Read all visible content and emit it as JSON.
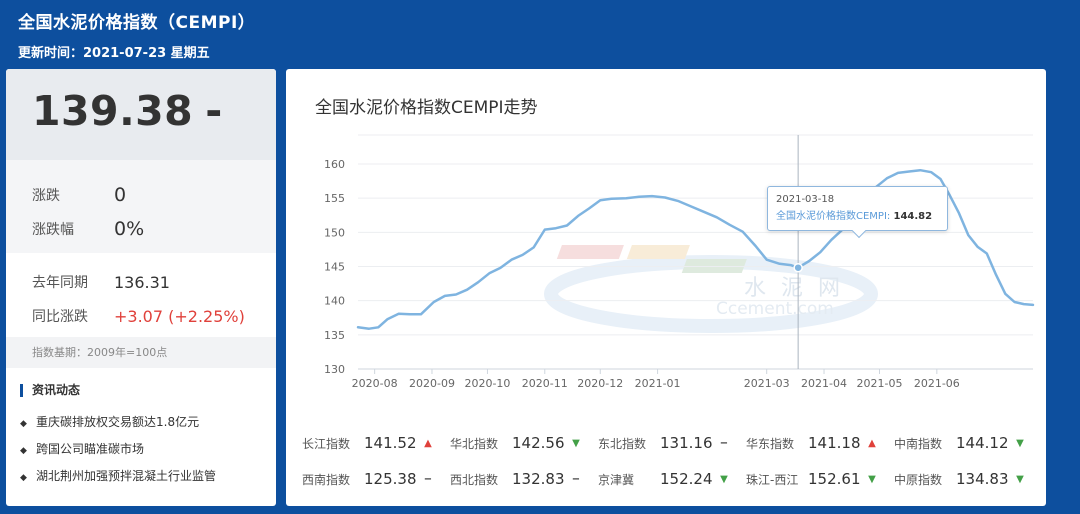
{
  "header": {
    "title": "全国水泥价格指数（CEMPI）",
    "update": "更新时间：2021-07-23 星期五"
  },
  "summary": {
    "price": "139.38",
    "price_arrow": "-",
    "change_label": "涨跌",
    "change_value": "0",
    "change_pct_label": "涨跌幅",
    "change_pct_value": "0%",
    "last_year_label": "去年同期",
    "last_year_value": "136.31",
    "yoy_label": "同比涨跌",
    "yoy_value": "+3.07",
    "yoy_pct": "(+2.25%)",
    "base_note": "指数基期：2009年=100点"
  },
  "news": {
    "title": "资讯动态",
    "items": [
      "重庆碳排放权交易额达1.8亿元",
      "跨国公司瞄准碳市场",
      "湖北荆州加强预拌混凝土行业监管"
    ]
  },
  "chart_title": "全国水泥价格指数CEMPI走势",
  "watermark": {
    "cn": "水 泥 网",
    "en": "Ccement.com"
  },
  "tooltip": {
    "date": "2021-03-18",
    "label": "全国水泥价格指数CEMPI",
    "value": "144.82"
  },
  "regions": [
    {
      "name": "长江指数",
      "value": "141.52",
      "dir": "up"
    },
    {
      "name": "华北指数",
      "value": "142.56",
      "dir": "down"
    },
    {
      "name": "东北指数",
      "value": "131.16",
      "dir": "flat"
    },
    {
      "name": "华东指数",
      "value": "141.18",
      "dir": "up"
    },
    {
      "name": "中南指数",
      "value": "144.12",
      "dir": "down"
    },
    {
      "name": "西南指数",
      "value": "125.38",
      "dir": "flat"
    },
    {
      "name": "西北指数",
      "value": "132.83",
      "dir": "flat"
    },
    {
      "name": "京津冀",
      "value": "152.24",
      "dir": "down"
    },
    {
      "name": "珠江-西江",
      "value": "152.61",
      "dir": "down"
    },
    {
      "name": "中原指数",
      "value": "134.83",
      "dir": "down"
    }
  ],
  "colors": {
    "background": "#0d4f9e",
    "line": "#7fb4e0",
    "up": "#e0413b",
    "down": "#43a047"
  },
  "chart_data": {
    "type": "line",
    "title": "全国水泥价格指数CEMPI走势",
    "xlabel": "",
    "ylabel": "",
    "ylim": [
      130,
      160
    ],
    "yticks": [
      130,
      135,
      140,
      145,
      150,
      155,
      160
    ],
    "xticks": [
      "2020-08",
      "2020-09",
      "2020-10",
      "2020-11",
      "2020-12",
      "2021-01",
      "2021-03",
      "2021-04",
      "2021-05",
      "2021-06"
    ],
    "xtick_dates": [
      "2020-08-01",
      "2020-09-01",
      "2020-10-01",
      "2020-11-01",
      "2020-12-01",
      "2021-01-01",
      "2021-03-01",
      "2021-04-01",
      "2021-05-01",
      "2021-06-01"
    ],
    "grid": true,
    "legend": "none",
    "series": [
      {
        "points": [
          [
            "2020-07-23",
            136.1
          ],
          [
            "2020-07-29",
            135.9
          ],
          [
            "2020-08-03",
            136.1
          ],
          [
            "2020-08-08",
            137.3
          ],
          [
            "2020-08-14",
            138.1
          ],
          [
            "2020-08-20",
            138.0
          ],
          [
            "2020-08-26",
            138.0
          ],
          [
            "2020-09-02",
            139.8
          ],
          [
            "2020-09-08",
            140.7
          ],
          [
            "2020-09-14",
            140.9
          ],
          [
            "2020-09-20",
            141.6
          ],
          [
            "2020-09-26",
            142.7
          ],
          [
            "2020-10-02",
            144.0
          ],
          [
            "2020-10-08",
            144.8
          ],
          [
            "2020-10-14",
            146.0
          ],
          [
            "2020-10-20",
            146.7
          ],
          [
            "2020-10-26",
            147.8
          ],
          [
            "2020-11-01",
            150.4
          ],
          [
            "2020-11-07",
            150.6
          ],
          [
            "2020-11-13",
            151.0
          ],
          [
            "2020-11-19",
            152.4
          ],
          [
            "2020-11-25",
            153.5
          ],
          [
            "2020-12-01",
            154.7
          ],
          [
            "2020-12-07",
            154.9
          ],
          [
            "2020-12-15",
            155.0
          ],
          [
            "2020-12-22",
            155.2
          ],
          [
            "2020-12-29",
            155.3
          ],
          [
            "2021-01-05",
            155.1
          ],
          [
            "2021-01-12",
            154.6
          ],
          [
            "2021-01-19",
            153.8
          ],
          [
            "2021-01-26",
            153.0
          ],
          [
            "2021-02-02",
            152.2
          ],
          [
            "2021-02-09",
            151.1
          ],
          [
            "2021-02-16",
            150.1
          ],
          [
            "2021-02-23",
            148.0
          ],
          [
            "2021-03-01",
            146.0
          ],
          [
            "2021-03-08",
            145.4
          ],
          [
            "2021-03-14",
            145.2
          ],
          [
            "2021-03-18",
            144.82
          ],
          [
            "2021-03-24",
            145.8
          ],
          [
            "2021-03-30",
            147.1
          ],
          [
            "2021-04-05",
            148.9
          ],
          [
            "2021-04-11",
            150.4
          ],
          [
            "2021-04-17",
            152.3
          ],
          [
            "2021-04-23",
            154.3
          ],
          [
            "2021-04-29",
            156.6
          ],
          [
            "2021-05-05",
            157.9
          ],
          [
            "2021-05-11",
            158.7
          ],
          [
            "2021-05-17",
            158.9
          ],
          [
            "2021-05-23",
            159.1
          ],
          [
            "2021-05-29",
            158.8
          ],
          [
            "2021-06-03",
            157.8
          ],
          [
            "2021-06-08",
            155.4
          ],
          [
            "2021-06-13",
            152.8
          ],
          [
            "2021-06-18",
            149.6
          ],
          [
            "2021-06-23",
            147.9
          ],
          [
            "2021-06-28",
            146.9
          ],
          [
            "2021-07-03",
            143.8
          ],
          [
            "2021-07-08",
            141.0
          ],
          [
            "2021-07-13",
            139.8
          ],
          [
            "2021-07-18",
            139.5
          ],
          [
            "2021-07-23",
            139.38
          ]
        ]
      }
    ]
  }
}
